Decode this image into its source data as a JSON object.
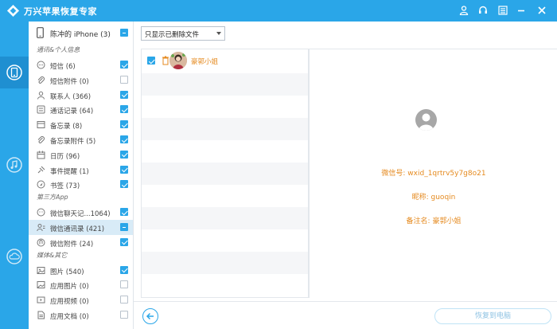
{
  "app": {
    "title": "万兴苹果恢复专家",
    "accent": "#2aa6e8",
    "orange": "#e58a1f"
  },
  "window_controls": [
    "user-icon",
    "headset-icon",
    "menu-icon",
    "minimize-icon",
    "close-icon"
  ],
  "rail": {
    "items": [
      "phone-restore-icon",
      "music-restore-icon",
      "cloud-restore-icon"
    ],
    "active": 0
  },
  "categories": {
    "device_label": "陈冲的 iPhone (3)",
    "device_checked": "partial",
    "sections": [
      {
        "title": "通讯&个人信息",
        "items": [
          {
            "icon": "sms-icon",
            "label": "短信 (6)",
            "checked": "on"
          },
          {
            "icon": "attachment-icon",
            "label": "短信附件 (0)",
            "checked": "off"
          },
          {
            "icon": "contact-icon",
            "label": "联系人 (366)",
            "checked": "on"
          },
          {
            "icon": "call-log-icon",
            "label": "通话记录 (64)",
            "checked": "on"
          },
          {
            "icon": "note-icon",
            "label": "备忘录 (8)",
            "checked": "on"
          },
          {
            "icon": "note-attachment-icon",
            "label": "备忘录附件 (5)",
            "checked": "on"
          },
          {
            "icon": "calendar-icon",
            "label": "日历 (96)",
            "checked": "on"
          },
          {
            "icon": "reminder-icon",
            "label": "事件提醒 (1)",
            "checked": "on"
          },
          {
            "icon": "bookmark-icon",
            "label": "书签 (73)",
            "checked": "on"
          }
        ]
      },
      {
        "title": "第三方App",
        "items": [
          {
            "icon": "wechat-chat-icon",
            "label": "微信聊天记...1064)",
            "checked": "on"
          },
          {
            "icon": "wechat-contacts-icon",
            "label": "微信通讯录 (421)",
            "checked": "partial",
            "selected": true
          },
          {
            "icon": "wechat-attachment-icon",
            "label": "微信附件 (24)",
            "checked": "on"
          }
        ]
      },
      {
        "title": "媒体&其它",
        "items": [
          {
            "icon": "photo-icon",
            "label": "图片 (540)",
            "checked": "on"
          },
          {
            "icon": "app-photo-icon",
            "label": "应用图片 (0)",
            "checked": "off"
          },
          {
            "icon": "app-video-icon",
            "label": "应用视频 (0)",
            "checked": "off"
          },
          {
            "icon": "app-document-icon",
            "label": "应用文档 (0)",
            "checked": "off"
          }
        ]
      }
    ]
  },
  "filter": {
    "selected": "只显示已删除文件"
  },
  "contact_list": [
    {
      "name": "豪郭小姐",
      "checked": true,
      "deleted": true
    }
  ],
  "detail": {
    "wechat_id": "微信号: wxid_1qrtrv5y7g8o21",
    "nickname": "昵称: guoqin",
    "remark": "备注名: 豪郭小姐"
  },
  "footer": {
    "recover_label": "恢复到电脑"
  }
}
